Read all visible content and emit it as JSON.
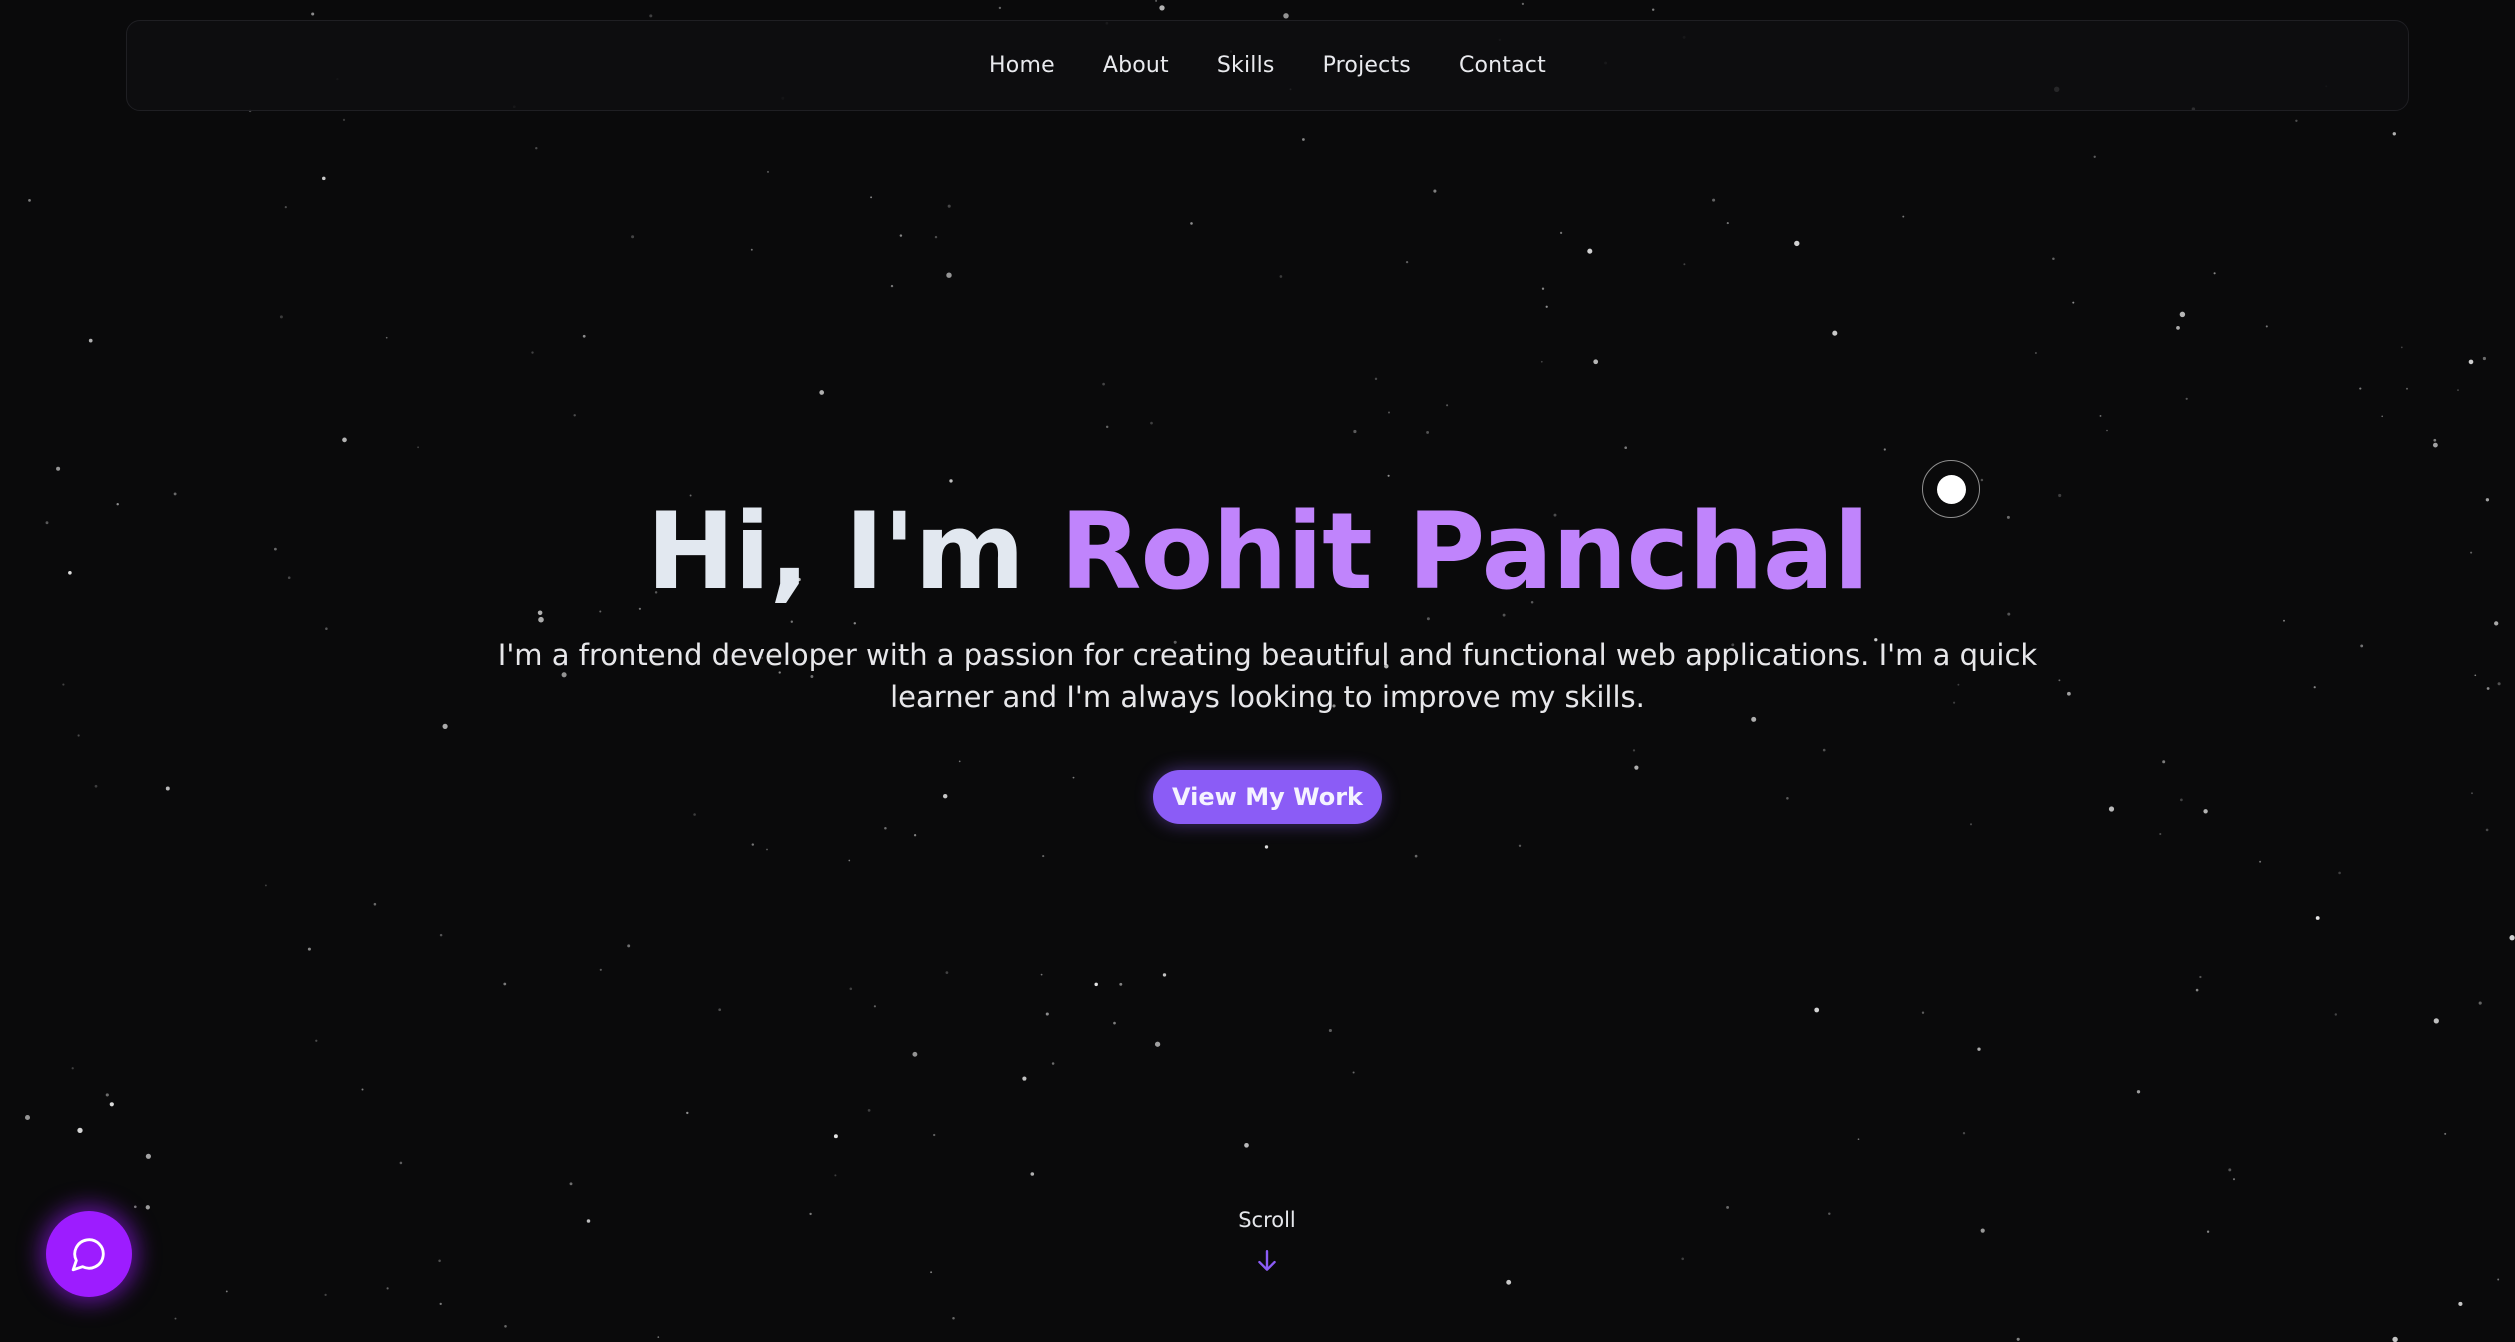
{
  "nav": {
    "items": [
      "Home",
      "About",
      "Skills",
      "Projects",
      "Contact"
    ]
  },
  "hero": {
    "greeting": "Hi, I'm",
    "name": "Rohit Panchal",
    "description": "I'm a frontend developer with a passion for creating beautiful and functional web applications. I'm a quick learner and I'm always looking to improve my skills.",
    "cta_label": "View My Work"
  },
  "scroll": {
    "label": "Scroll",
    "icon": "arrow-down-icon"
  },
  "chat": {
    "icon": "chat-bubble-icon"
  },
  "colors": {
    "background": "#0a0a0b",
    "accent_name": "#c084fc",
    "cta_background": "#8b5cf6",
    "chat_button": "#9d1cff",
    "scroll_arrow": "#8b5cf6"
  }
}
